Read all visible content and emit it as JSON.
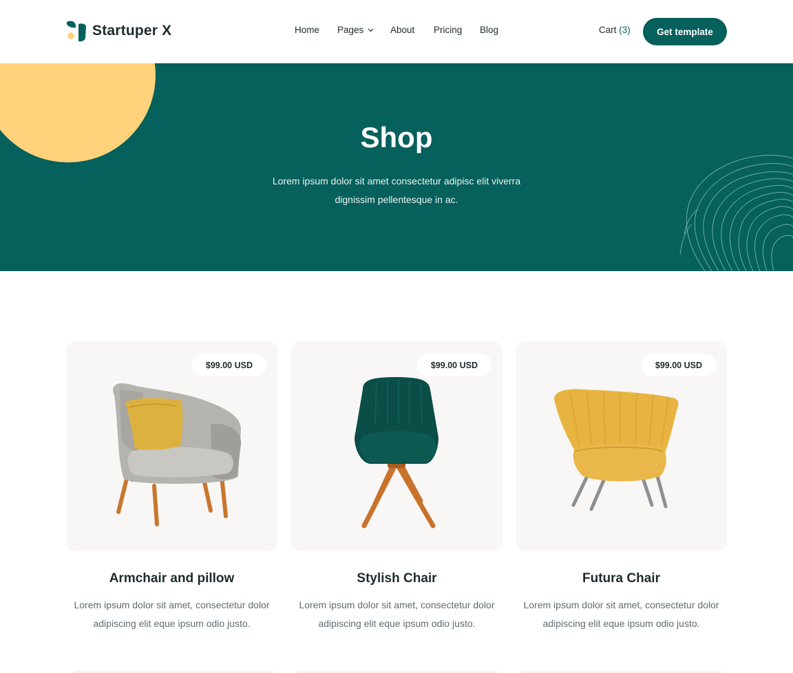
{
  "brand": {
    "name": "Startuper X",
    "colors": {
      "primary": "#06605c",
      "accent": "#ffd37b"
    }
  },
  "nav": {
    "items": [
      {
        "label": "Home"
      },
      {
        "label": "Pages",
        "has_dropdown": true
      },
      {
        "label": "About"
      },
      {
        "label": "Pricing"
      },
      {
        "label": "Blog"
      }
    ],
    "cart": {
      "label": "Cart",
      "count": "(3)"
    },
    "cta": "Get template"
  },
  "hero": {
    "title": "Shop",
    "subtitle": "Lorem ipsum dolor sit amet consectetur adipisc elit viverra dignissim pellentesque in ac."
  },
  "products": [
    {
      "price": "$99.00 USD",
      "title": "Armchair and pillow",
      "description": "Lorem ipsum dolor sit amet, consectetur dolor adipiscing elit eque ipsum odio justo.",
      "image": "grey-armchair-yellow-pillow"
    },
    {
      "price": "$99.00 USD",
      "title": "Stylish Chair",
      "description": "Lorem ipsum dolor sit amet, consectetur dolor adipiscing elit eque ipsum odio justo.",
      "image": "green-swivel-chair"
    },
    {
      "price": "$99.00 USD",
      "title": "Futura Chair",
      "description": "Lorem ipsum dolor sit amet, consectetur dolor adipiscing elit eque ipsum odio justo.",
      "image": "yellow-tub-chair"
    }
  ]
}
